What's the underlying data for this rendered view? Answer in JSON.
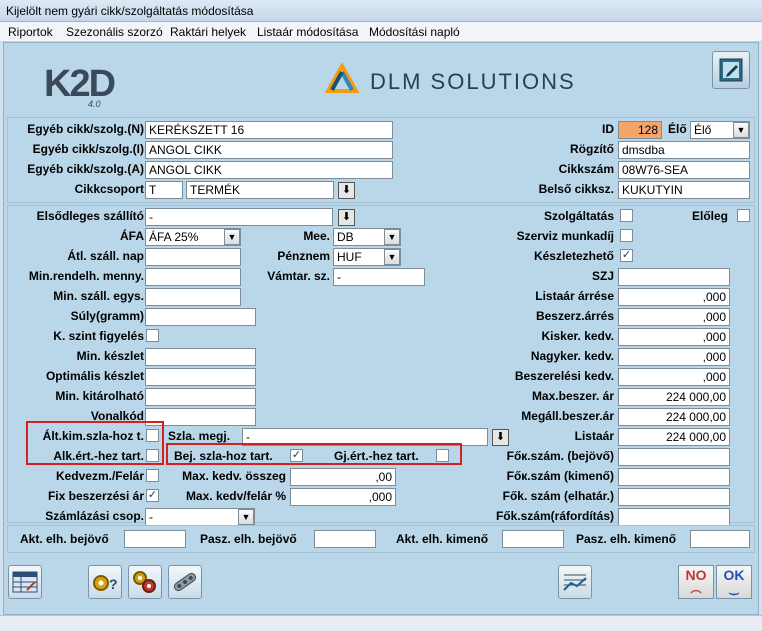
{
  "window": {
    "title": "Kijelölt nem gyári cikk/szolgáltatás módosítása"
  },
  "menu": [
    "Riportok",
    "Szezonális szorzó",
    "Raktári helyek",
    "Listaár módosítása",
    "Módosítási napló"
  ],
  "logos": {
    "k2d": "K2D",
    "k2d_version": "4.0",
    "company": "DLM SOLUTIONS"
  },
  "header": {
    "name_n_label": "Egyéb cikk/szolg.(N)",
    "name_n": "KERÉKSZETT 16",
    "name_i_label": "Egyéb cikk/szolg.(I)",
    "name_i": "ANGOL CIKK",
    "name_a_label": "Egyéb cikk/szolg.(A)",
    "name_a": "ANGOL CIKK",
    "group_label": "Cikkcsoport",
    "group_code": "T",
    "group_name": "TERMÉK",
    "id_label": "ID",
    "id": "128",
    "elo_label": "Élő",
    "elo": "Élő",
    "recorder_label": "Rögzítő",
    "recorder": "dmsdba",
    "item_no_label": "Cikkszám",
    "item_no": "08W76-SEA",
    "internal_label": "Belső cikksz.",
    "internal": "KUKUTYIN"
  },
  "details": {
    "supplier_label": "Elsődleges szállító",
    "supplier": "-",
    "vat_label": "ÁFA",
    "vat": "ÁFA 25%",
    "unit_label": "Mee.",
    "unit": "DB",
    "avg_days_label": "Átl. száll. nap",
    "avg_days": "",
    "currency_label": "Pénznem",
    "currency": "HUF",
    "min_order_label": "Min.rendelh. menny.",
    "min_order": "",
    "customs_label": "Vámtar. sz.",
    "customs": "-",
    "min_unit_label": "Min. száll. egys.",
    "min_unit": "",
    "weight_label": "Súly(gramm)",
    "weight": "",
    "k_level_label": "K. szint figyelés",
    "min_stock_label": "Min. készlet",
    "min_stock": "",
    "opt_stock_label": "Optimális készlet",
    "opt_stock": "",
    "min_out_label": "Min. kitárolható",
    "min_out": "",
    "barcode_label": "Vonalkód",
    "barcode": "",
    "alt_kim_label": "Ált.kim.szla-hoz t.",
    "szla_megj_label": "Szla. megj.",
    "szla_megj": "-",
    "alk_ert_label": "Alk.ért.-hez tart.",
    "bej_szla_label": "Bej. szla-hoz tart.",
    "gj_ert_label": "Gj.ért.-hez tart.",
    "discount_label": "Kedvezm./Felár",
    "max_disc_amt_label": "Max. kedv. összeg",
    "max_disc_amt": ",00",
    "fixed_price_label": "Fix beszerzési ár",
    "max_disc_pct_label": "Max. kedv/felár %",
    "max_disc_pct": ",000",
    "billing_group_label": "Számlázási csop.",
    "billing_group": "-",
    "service_label": "Szolgáltatás",
    "advance_label": "Előleg",
    "service_work_label": "Szerviz munkadíj",
    "stock_label": "Készletezhető",
    "szj_label": "SZJ",
    "szj": "",
    "list_margin_label": "Listaár árrése",
    "list_margin": ",000",
    "purchase_margin_label": "Beszerz.árrés",
    "purchase_margin": ",000",
    "retail_disc_label": "Kisker. kedv.",
    "retail_disc": ",000",
    "wholesale_disc_label": "Nagyker. kedv.",
    "wholesale_disc": ",000",
    "purchase_disc_label": "Beszerelési kedv.",
    "purchase_disc": ",000",
    "max_purchase_label": "Max.beszer. ár",
    "max_purchase": "224 000,00",
    "fixed_purchase_label": "Megáll.beszer.ár",
    "fixed_purchase": "224 000,00",
    "list_price_label": "Listaár",
    "list_price": "224 000,00",
    "ledger_in_label": "Főк.szám. (bejövő)",
    "ledger_in": "",
    "ledger_out_label": "Főк.szám (kimenő)",
    "ledger_out": "",
    "ledger_acc_label": "Fők. szám (elhatár.)",
    "ledger_acc": "",
    "ledger_exp_label": "Fők.szám(ráfordítás)",
    "ledger_exp": ""
  },
  "bottom": {
    "akt_in_label": "Akt. elh. bejövő",
    "akt_in": "",
    "pasz_in_label": "Pasz. elh. bejövő",
    "pasz_in": "",
    "akt_out_label": "Akt. elh. kimenő",
    "akt_out": "",
    "pasz_out_label": "Pasz. elh. kimenő",
    "pasz_out": ""
  },
  "buttons": {
    "no": "NO",
    "ok": "OK"
  },
  "colors": {
    "id_bg": "#f5a46a",
    "red_box": "#d62020",
    "panel_bg": "#b9d7e8"
  },
  "icons": [
    "edit-icon",
    "grid-icon",
    "help-gears-icon",
    "gears-icon",
    "chain-icon",
    "chart-icon"
  ]
}
